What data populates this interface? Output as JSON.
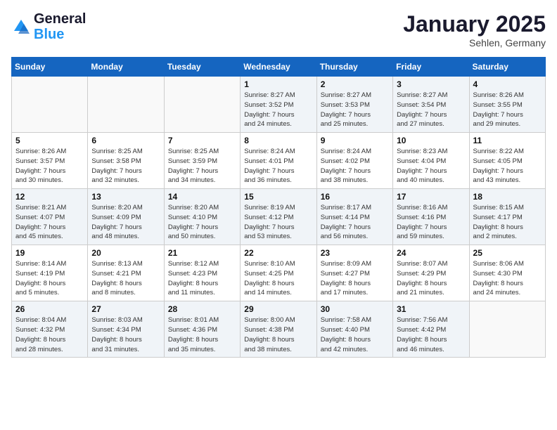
{
  "header": {
    "logo_line1": "General",
    "logo_line2": "Blue",
    "month_title": "January 2025",
    "location": "Sehlen, Germany"
  },
  "days_of_week": [
    "Sunday",
    "Monday",
    "Tuesday",
    "Wednesday",
    "Thursday",
    "Friday",
    "Saturday"
  ],
  "weeks": [
    [
      {
        "day": "",
        "detail": ""
      },
      {
        "day": "",
        "detail": ""
      },
      {
        "day": "",
        "detail": ""
      },
      {
        "day": "1",
        "detail": "Sunrise: 8:27 AM\nSunset: 3:52 PM\nDaylight: 7 hours\nand 24 minutes."
      },
      {
        "day": "2",
        "detail": "Sunrise: 8:27 AM\nSunset: 3:53 PM\nDaylight: 7 hours\nand 25 minutes."
      },
      {
        "day": "3",
        "detail": "Sunrise: 8:27 AM\nSunset: 3:54 PM\nDaylight: 7 hours\nand 27 minutes."
      },
      {
        "day": "4",
        "detail": "Sunrise: 8:26 AM\nSunset: 3:55 PM\nDaylight: 7 hours\nand 29 minutes."
      }
    ],
    [
      {
        "day": "5",
        "detail": "Sunrise: 8:26 AM\nSunset: 3:57 PM\nDaylight: 7 hours\nand 30 minutes."
      },
      {
        "day": "6",
        "detail": "Sunrise: 8:25 AM\nSunset: 3:58 PM\nDaylight: 7 hours\nand 32 minutes."
      },
      {
        "day": "7",
        "detail": "Sunrise: 8:25 AM\nSunset: 3:59 PM\nDaylight: 7 hours\nand 34 minutes."
      },
      {
        "day": "8",
        "detail": "Sunrise: 8:24 AM\nSunset: 4:01 PM\nDaylight: 7 hours\nand 36 minutes."
      },
      {
        "day": "9",
        "detail": "Sunrise: 8:24 AM\nSunset: 4:02 PM\nDaylight: 7 hours\nand 38 minutes."
      },
      {
        "day": "10",
        "detail": "Sunrise: 8:23 AM\nSunset: 4:04 PM\nDaylight: 7 hours\nand 40 minutes."
      },
      {
        "day": "11",
        "detail": "Sunrise: 8:22 AM\nSunset: 4:05 PM\nDaylight: 7 hours\nand 43 minutes."
      }
    ],
    [
      {
        "day": "12",
        "detail": "Sunrise: 8:21 AM\nSunset: 4:07 PM\nDaylight: 7 hours\nand 45 minutes."
      },
      {
        "day": "13",
        "detail": "Sunrise: 8:20 AM\nSunset: 4:09 PM\nDaylight: 7 hours\nand 48 minutes."
      },
      {
        "day": "14",
        "detail": "Sunrise: 8:20 AM\nSunset: 4:10 PM\nDaylight: 7 hours\nand 50 minutes."
      },
      {
        "day": "15",
        "detail": "Sunrise: 8:19 AM\nSunset: 4:12 PM\nDaylight: 7 hours\nand 53 minutes."
      },
      {
        "day": "16",
        "detail": "Sunrise: 8:17 AM\nSunset: 4:14 PM\nDaylight: 7 hours\nand 56 minutes."
      },
      {
        "day": "17",
        "detail": "Sunrise: 8:16 AM\nSunset: 4:16 PM\nDaylight: 7 hours\nand 59 minutes."
      },
      {
        "day": "18",
        "detail": "Sunrise: 8:15 AM\nSunset: 4:17 PM\nDaylight: 8 hours\nand 2 minutes."
      }
    ],
    [
      {
        "day": "19",
        "detail": "Sunrise: 8:14 AM\nSunset: 4:19 PM\nDaylight: 8 hours\nand 5 minutes."
      },
      {
        "day": "20",
        "detail": "Sunrise: 8:13 AM\nSunset: 4:21 PM\nDaylight: 8 hours\nand 8 minutes."
      },
      {
        "day": "21",
        "detail": "Sunrise: 8:12 AM\nSunset: 4:23 PM\nDaylight: 8 hours\nand 11 minutes."
      },
      {
        "day": "22",
        "detail": "Sunrise: 8:10 AM\nSunset: 4:25 PM\nDaylight: 8 hours\nand 14 minutes."
      },
      {
        "day": "23",
        "detail": "Sunrise: 8:09 AM\nSunset: 4:27 PM\nDaylight: 8 hours\nand 17 minutes."
      },
      {
        "day": "24",
        "detail": "Sunrise: 8:07 AM\nSunset: 4:29 PM\nDaylight: 8 hours\nand 21 minutes."
      },
      {
        "day": "25",
        "detail": "Sunrise: 8:06 AM\nSunset: 4:30 PM\nDaylight: 8 hours\nand 24 minutes."
      }
    ],
    [
      {
        "day": "26",
        "detail": "Sunrise: 8:04 AM\nSunset: 4:32 PM\nDaylight: 8 hours\nand 28 minutes."
      },
      {
        "day": "27",
        "detail": "Sunrise: 8:03 AM\nSunset: 4:34 PM\nDaylight: 8 hours\nand 31 minutes."
      },
      {
        "day": "28",
        "detail": "Sunrise: 8:01 AM\nSunset: 4:36 PM\nDaylight: 8 hours\nand 35 minutes."
      },
      {
        "day": "29",
        "detail": "Sunrise: 8:00 AM\nSunset: 4:38 PM\nDaylight: 8 hours\nand 38 minutes."
      },
      {
        "day": "30",
        "detail": "Sunrise: 7:58 AM\nSunset: 4:40 PM\nDaylight: 8 hours\nand 42 minutes."
      },
      {
        "day": "31",
        "detail": "Sunrise: 7:56 AM\nSunset: 4:42 PM\nDaylight: 8 hours\nand 46 minutes."
      },
      {
        "day": "",
        "detail": ""
      }
    ]
  ]
}
